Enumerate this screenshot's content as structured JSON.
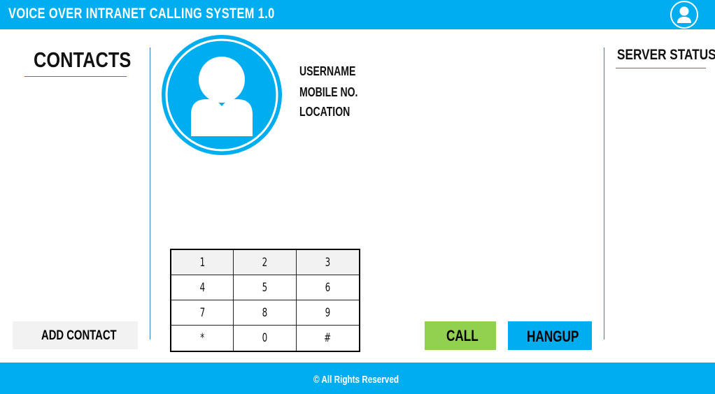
{
  "app": {
    "title": "VOICE OVER INTRANET CALLING SYSTEM 1.0",
    "accent_color": "#00aeef",
    "user_icon": "user-avatar-icon"
  },
  "contacts": {
    "title": "CONTACTS",
    "add_button_label": "ADD CONTACT"
  },
  "profile": {
    "avatar_icon": "user-avatar-icon",
    "username_label": "USERNAME",
    "mobile_label": "MOBILE NO.",
    "location_label": "LOCATION"
  },
  "keypad": {
    "keys": [
      "1",
      "2",
      "3",
      "4",
      "5",
      "6",
      "7",
      "8",
      "9",
      "*",
      "0",
      "#"
    ]
  },
  "actions": {
    "call_label": "CALL",
    "call_color": "#92d050",
    "hangup_label": "HANGUP",
    "hangup_color": "#00aeef"
  },
  "server": {
    "title": "SERVER STATUS"
  },
  "footer": {
    "text": "© All Rights Reserved"
  }
}
